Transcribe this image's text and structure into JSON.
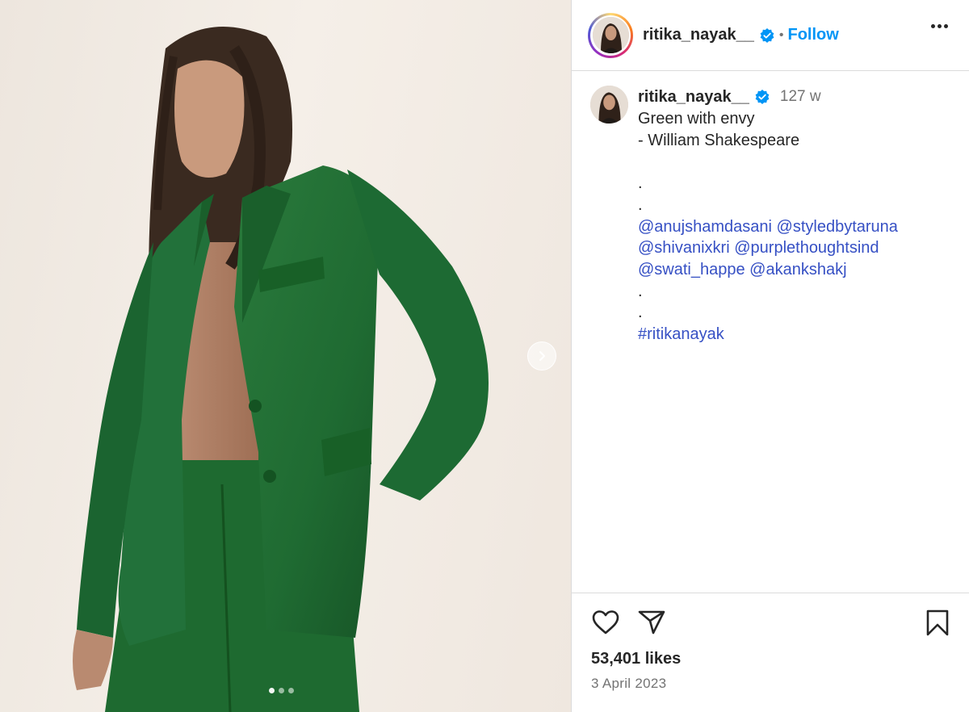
{
  "post": {
    "image_alt": "Woman in a green oversized suit",
    "carousel_dots": 3,
    "active_dot": 0
  },
  "header": {
    "username": "ritika_nayak__",
    "separator": "•",
    "follow_label": "Follow"
  },
  "caption": {
    "username": "ritika_nayak__",
    "time_ago": "127 w",
    "lines": [
      {
        "type": "text",
        "text": "Green with envy"
      },
      {
        "type": "text",
        "text": "- William Shakespeare"
      },
      {
        "type": "blank",
        "text": ""
      },
      {
        "type": "text",
        "text": "."
      },
      {
        "type": "text",
        "text": "."
      },
      {
        "type": "tags",
        "tags": [
          "@anujshamdasani",
          "@styledbytaruna"
        ]
      },
      {
        "type": "tags",
        "tags": [
          "@shivanixkri",
          "@purplethoughtsind"
        ]
      },
      {
        "type": "tags",
        "tags": [
          "@swati_happe",
          "@akankshakj"
        ]
      },
      {
        "type": "text",
        "text": "."
      },
      {
        "type": "text",
        "text": "."
      },
      {
        "type": "tags",
        "tags": [
          "#ritikanayak"
        ]
      }
    ]
  },
  "footer": {
    "likes": "53,401 likes",
    "date": "3 April 2023"
  },
  "colors": {
    "follow": "#0095f6",
    "verified": "#0095f6",
    "tag_link": "#3650c4",
    "suit_green": "#1f6b32"
  }
}
